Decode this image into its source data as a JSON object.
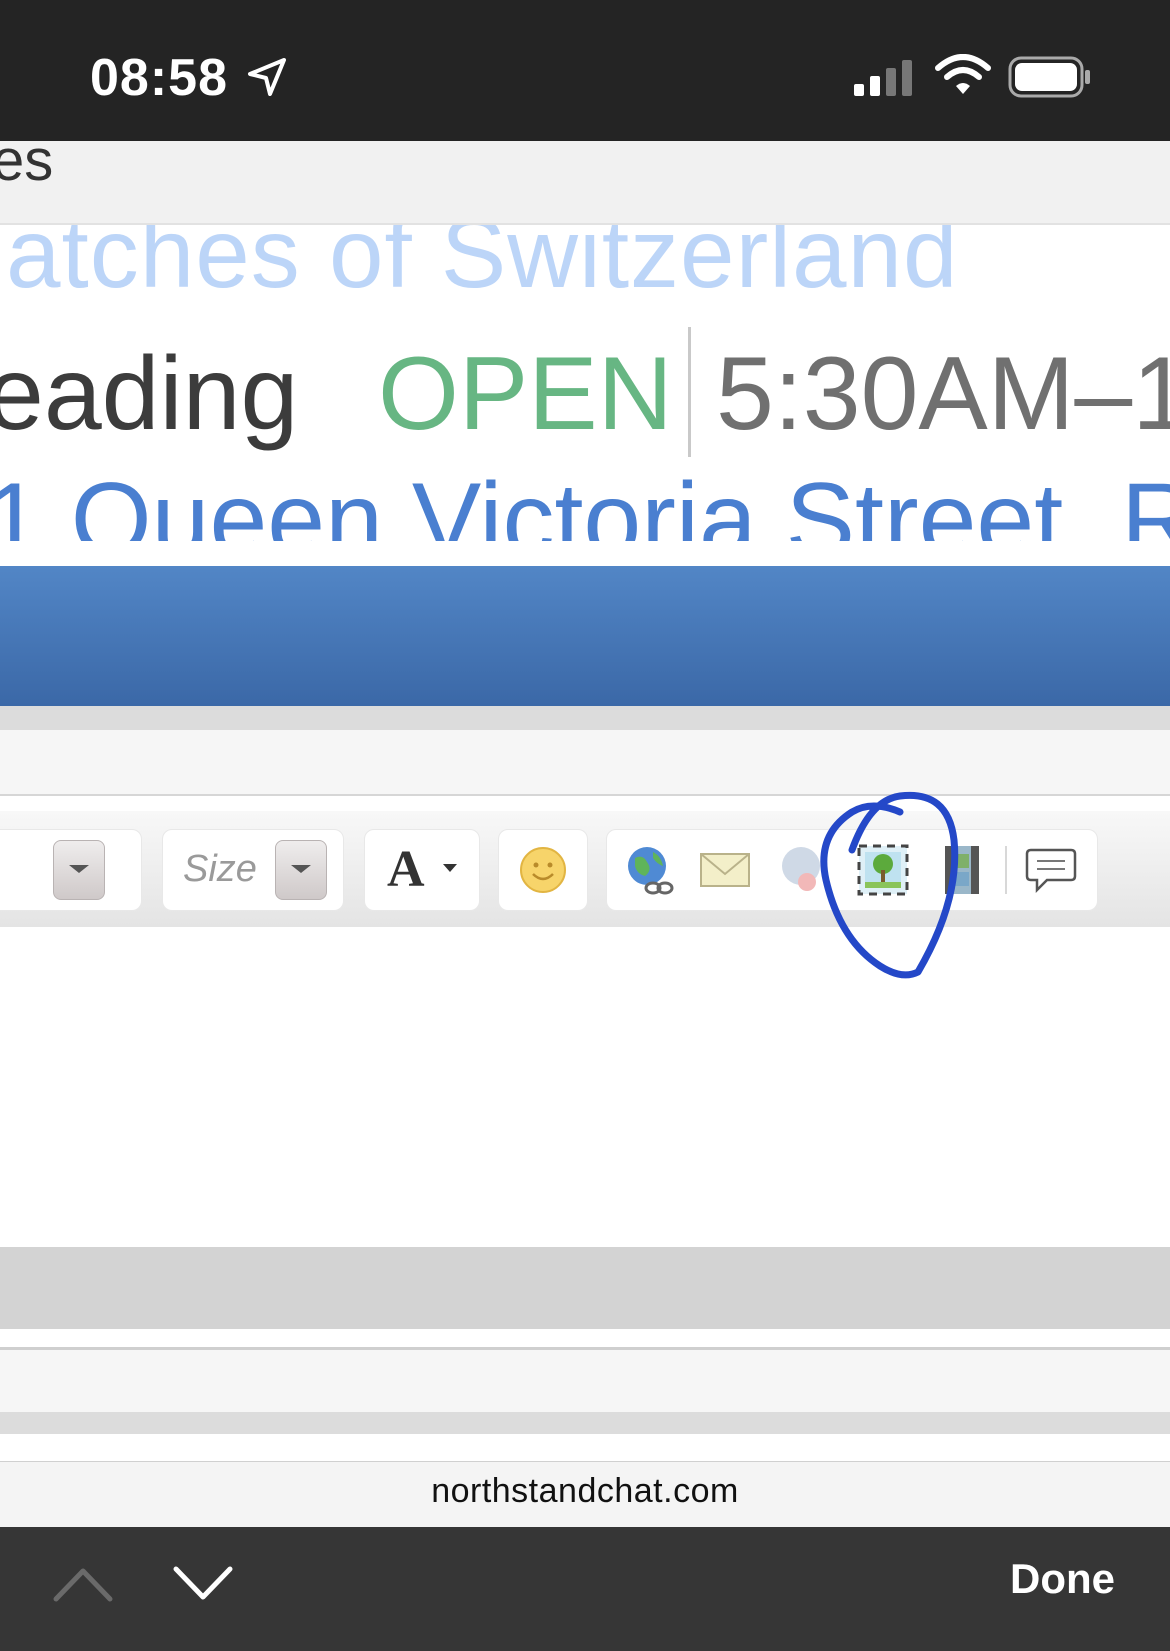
{
  "status_bar": {
    "time": "08:58",
    "icons": [
      "location-arrow-icon",
      "cellular-signal-icon",
      "wifi-icon",
      "battery-icon"
    ]
  },
  "page": {
    "top_fragment": "es",
    "ad": {
      "title": "atches of Switzerland",
      "place": "eading",
      "status": "OPEN",
      "hours": "5:30AM–1",
      "address": "1 Queen Victoria Street, R"
    },
    "toolbar": {
      "size_label": "Size",
      "icons": [
        "text-color-icon",
        "smiley-icon",
        "insert-link-icon",
        "email-icon",
        "remove-link-icon",
        "insert-image-icon",
        "insert-video-icon",
        "quote-icon"
      ]
    }
  },
  "browser": {
    "url": "northstandchat.com",
    "done_label": "Done"
  },
  "colors": {
    "status_bar": "#242424",
    "blue_bar": "#4a7bbd",
    "open_green": "#67b683",
    "annotation_blue": "#2448c8",
    "find_bar": "#363636"
  }
}
